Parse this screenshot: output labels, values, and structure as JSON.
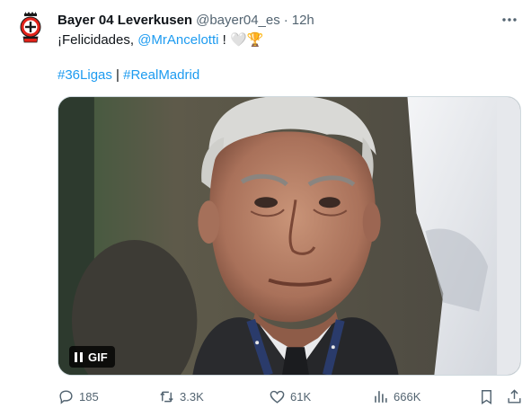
{
  "tweet": {
    "display_name": "Bayer 04 Leverkusen",
    "handle": "@bayer04_es",
    "separator": "·",
    "time": "12h",
    "text_prefix": "¡Felicidades, ",
    "mention": "@MrAncelotti",
    "text_suffix": " ! ",
    "emoji": "🤍🏆",
    "hashtag1": "#36Ligas",
    "hashtag_separator": " | ",
    "hashtag2": "#RealMadrid",
    "media_badge": "GIF"
  },
  "actions": {
    "replies": "185",
    "retweets": "3.3K",
    "likes": "61K",
    "views": "666K"
  },
  "colors": {
    "accent": "#1d9bf0",
    "muted": "#536471",
    "text": "#0f1419"
  },
  "icons": [
    "bayer-logo-icon",
    "more-icon",
    "pause-icon",
    "reply-icon",
    "retweet-icon",
    "like-icon",
    "views-icon",
    "bookmark-icon",
    "share-icon"
  ]
}
